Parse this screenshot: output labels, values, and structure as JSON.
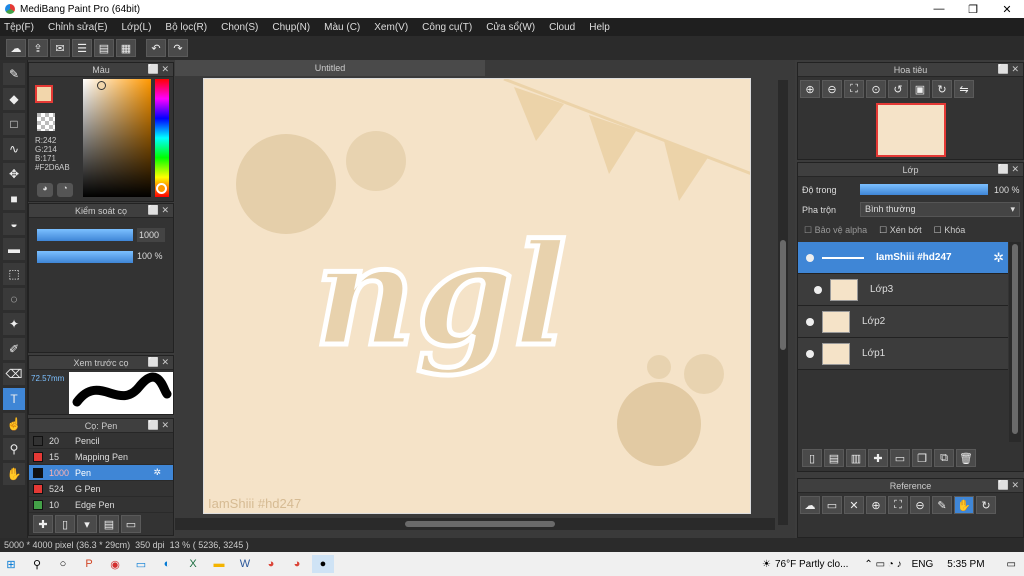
{
  "window": {
    "title": "MediBang Paint Pro (64bit)",
    "min": "—",
    "max": "❐",
    "close": "✕"
  },
  "menu": [
    "Tệp(F)",
    "Chỉnh sửa(E)",
    "Lớp(L)",
    "Bộ lọc(R)",
    "Chọn(S)",
    "Chụp(N)",
    "Màu (C)",
    "Xem(V)",
    "Công cụ(T)",
    "Cửa sổ(W)",
    "Cloud",
    "Help"
  ],
  "toolbar": {
    "undo": "↶",
    "redo": "↷"
  },
  "document": {
    "tab": "Untitled",
    "watermark": "IamShiii #hd247",
    "text": "ngl"
  },
  "color_panel": {
    "title": "Màu",
    "r": "R:242",
    "g": "G:214",
    "b": "B:171",
    "hex": "#F2D6AB",
    "fg_color": "#F2D6AB",
    "accent": "#e53935"
  },
  "brush_control": {
    "title": "Kiểm soát cọ",
    "size": "1000",
    "opacity": "100 %"
  },
  "brush_preview": {
    "title": "Xem trước cọ",
    "size_label": "72.57mm"
  },
  "brush_list": {
    "title": "Cọ: Pen",
    "items": [
      {
        "size": "20",
        "name": "Pencil",
        "color": "#333333"
      },
      {
        "size": "15",
        "name": "Mapping Pen",
        "color": "#e53935"
      },
      {
        "size": "1000",
        "name": "Pen",
        "color": "#111111",
        "selected": true
      },
      {
        "size": "524",
        "name": "G Pen",
        "color": "#e53935"
      },
      {
        "size": "10",
        "name": "Edge Pen",
        "color": "#43a047"
      }
    ]
  },
  "navigator": {
    "title": "Hoa tiêu"
  },
  "layers": {
    "title": "Lớp",
    "opacity_label": "Độ trong",
    "opacity_value": "100 %",
    "blend_label": "Pha trộn",
    "blend_value": "Bình thường",
    "protect_alpha": "Bảo vệ alpha",
    "clipping": "Xén bớt",
    "lock": "Khóa",
    "items": [
      {
        "name": "IamShiii #hd247",
        "selected": true
      },
      {
        "name": "Lớp3"
      },
      {
        "name": "Lớp2"
      },
      {
        "name": "Lớp1"
      }
    ]
  },
  "reference": {
    "title": "Reference"
  },
  "status": {
    "size": "5000 * 4000 pixel",
    "cm": "(36.3 * 29cm)",
    "dpi": "350 dpi",
    "zoom": "13 %",
    "coords": "( 5236, 3245 )"
  },
  "taskbar": {
    "weather": "76°F Partly clo...",
    "lang": "ENG",
    "time": "5:35 PM"
  }
}
